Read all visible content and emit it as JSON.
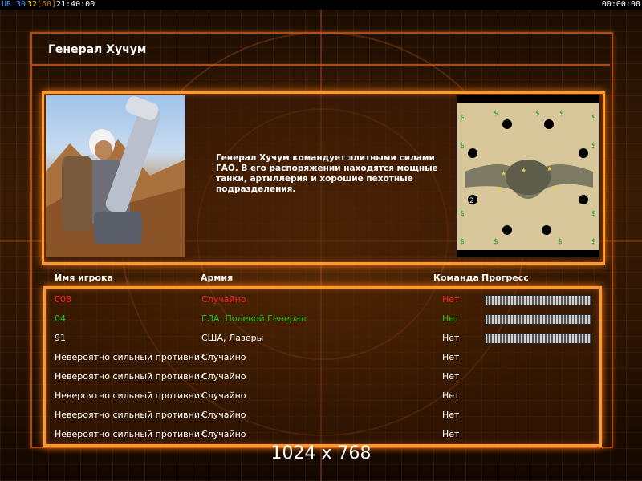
{
  "status_bar": {
    "ur": "UR",
    "v30": "30",
    "v32": "32",
    "v60": "[60]",
    "clock": "21:40:00",
    "timer": "00:00:00"
  },
  "page": {
    "title": "Генерал Хучум",
    "description": "Генерал Хучум командует элитными силами ГАО. В его распоряжении находятся мощные танки, артиллерия и хорошие пехотные подразделения.",
    "resolution": "1024 x 768"
  },
  "colors": {
    "accent": "#ff9a2a",
    "player_red": "#ff2020",
    "player_green": "#20c020",
    "text": "#ffffff"
  },
  "table": {
    "headers": {
      "player": "Имя игрока",
      "army": "Армия",
      "team": "Команда",
      "progress": "Прогресс"
    },
    "rows": [
      {
        "player": "008",
        "army": "Случайно",
        "team": "Нет",
        "color": "#ff2020",
        "has_progress": true
      },
      {
        "player": "04",
        "army": "ГЛА, Полевой Генерал",
        "team": "Нет",
        "color": "#20c020",
        "has_progress": true
      },
      {
        "player": "91",
        "army": "США, Лазеры",
        "team": "Нет",
        "color": "#ffffff",
        "has_progress": true
      },
      {
        "player": "Невероятно сильный противник",
        "army": "Случайно",
        "team": "Нет",
        "color": "#ffffff",
        "has_progress": false
      },
      {
        "player": "Невероятно сильный противник",
        "army": "Случайно",
        "team": "Нет",
        "color": "#ffffff",
        "has_progress": false
      },
      {
        "player": "Невероятно сильный противник",
        "army": "Случайно",
        "team": "Нет",
        "color": "#ffffff",
        "has_progress": false
      },
      {
        "player": "Невероятно сильный противник",
        "army": "Случайно",
        "team": "Нет",
        "color": "#ffffff",
        "has_progress": false
      },
      {
        "player": "Невероятно сильный противник",
        "army": "Случайно",
        "team": "Нет",
        "color": "#ffffff",
        "has_progress": false
      }
    ]
  },
  "map": {
    "start_label": "2"
  }
}
